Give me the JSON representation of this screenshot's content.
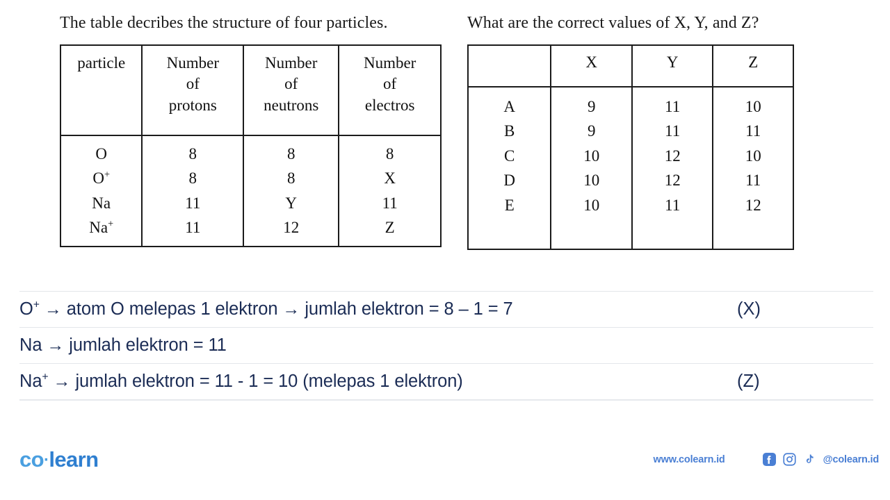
{
  "question": {
    "left_prompt": "The table decribes the structure of four particles.",
    "right_prompt": "What are the correct values of X, Y, and Z?"
  },
  "left_table": {
    "headers": [
      "particle",
      "Number of protons",
      "Number of neutrons",
      "Number of electros"
    ],
    "header_lines": [
      [
        "particle"
      ],
      [
        "Number",
        "of",
        "protons"
      ],
      [
        "Number",
        "of",
        "neutrons"
      ],
      [
        "Number",
        "of",
        "electros"
      ]
    ],
    "columns": {
      "particle": [
        "O",
        "O+",
        "Na",
        "Na+"
      ],
      "protons": [
        "8",
        "8",
        "11",
        "11"
      ],
      "neutrons": [
        "8",
        "8",
        "Y",
        "12"
      ],
      "electrons": [
        "8",
        "X",
        "11",
        "Z"
      ]
    },
    "rows": [
      {
        "particle": "O",
        "particle_base": "O",
        "particle_sup": "",
        "protons": "8",
        "neutrons": "8",
        "electrons": "8"
      },
      {
        "particle": "O+",
        "particle_base": "O",
        "particle_sup": "+",
        "protons": "8",
        "neutrons": "8",
        "electrons": "X"
      },
      {
        "particle": "Na",
        "particle_base": "Na",
        "particle_sup": "",
        "protons": "11",
        "neutrons": "Y",
        "electrons": "11"
      },
      {
        "particle": "Na+",
        "particle_base": "Na",
        "particle_sup": "+",
        "protons": "11",
        "neutrons": "12",
        "electrons": "Z"
      }
    ]
  },
  "right_table": {
    "headers": [
      "",
      "X",
      "Y",
      "Z"
    ],
    "columns": {
      "option": [
        "A",
        "B",
        "C",
        "D",
        "E"
      ],
      "X": [
        "9",
        "9",
        "10",
        "10",
        "10"
      ],
      "Y": [
        "11",
        "11",
        "12",
        "12",
        "11"
      ],
      "Z": [
        "10",
        "11",
        "10",
        "11",
        "12"
      ]
    },
    "rows": [
      {
        "option": "A",
        "X": "9",
        "Y": "11",
        "Z": "10"
      },
      {
        "option": "B",
        "X": "9",
        "Y": "11",
        "Z": "11"
      },
      {
        "option": "C",
        "X": "10",
        "Y": "12",
        "Z": "10"
      },
      {
        "option": "D",
        "X": "10",
        "Y": "12",
        "Z": "11"
      },
      {
        "option": "E",
        "X": "10",
        "Y": "11",
        "Z": "12"
      }
    ]
  },
  "solution": {
    "color": "#1b2c55",
    "lines": [
      {
        "text": "O+ → atom O melepas 1 elektron → jumlah elektron = 8 – 1 = 7",
        "tag": "(X)"
      },
      {
        "text": "Na → jumlah elektron = 11",
        "tag": ""
      },
      {
        "text": "Na+ → jumlah elektron = 11 - 1 = 10 (melepas 1 elektron)",
        "tag": "(Z)"
      }
    ],
    "line1_prefix_base": "O",
    "line1_prefix_sup": "+",
    "line1_rest": " atom O melepas 1 elektron ",
    "line1_tail": " jumlah elektron = 8 – 1 = 7",
    "line1_tag": "(X)",
    "line2_prefix": "Na ",
    "line2_tail": " jumlah elektron = 11",
    "line3_prefix_base": "Na",
    "line3_prefix_sup": "+",
    "line3_tail": " jumlah elektron = 11 - 1 = 10 (melepas 1 elektron)",
    "line3_tag": "(Z)",
    "arrow": "→"
  },
  "footer": {
    "logo_co": "co",
    "logo_dot": "·",
    "logo_learn": "learn",
    "website": "www.colearn.id",
    "handle": "@colearn.id",
    "icons": [
      "facebook-icon",
      "instagram-icon",
      "tiktok-icon"
    ],
    "brand_blue": "#4a7fd4",
    "logo_light_blue": "#4a9fe0",
    "logo_dark_blue": "#2f7fd0"
  }
}
